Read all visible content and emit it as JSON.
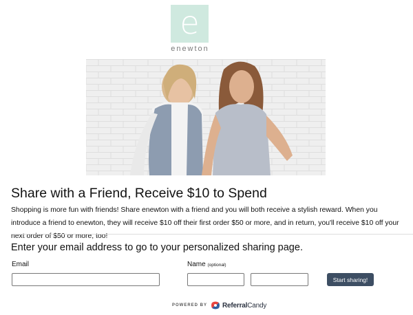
{
  "logo": {
    "letter": "e",
    "wordmark": "enewton"
  },
  "hero": {
    "alt": "Two women smiling in front of a white brick wall"
  },
  "heading": "Share with a Friend, Receive $10 to Spend",
  "description": "Shopping is more fun with friends! Share enewton with a friend and you will both receive a stylish reward. When you introduce a friend to enewton, they will receive $10 off their first order $50 or more, and in return, you'll receive $10 off your next order of $50 or more, too!",
  "form": {
    "prompt": "Enter your email address to go to your personalized sharing page.",
    "email_label": "Email",
    "email_value": "",
    "name_label": "Name",
    "name_optional": "(optional)",
    "first_name_value": "",
    "last_name_value": "",
    "submit_label": "Start sharing!"
  },
  "footer": {
    "powered_by": "POWERED BY",
    "brand_bold": "Referral",
    "brand_regular": "Candy"
  },
  "colors": {
    "logo_bg": "#cfe9df",
    "button_bg": "#3d4e63"
  },
  "icons": [
    "enewton-logo",
    "referralcandy-logo-icon"
  ]
}
